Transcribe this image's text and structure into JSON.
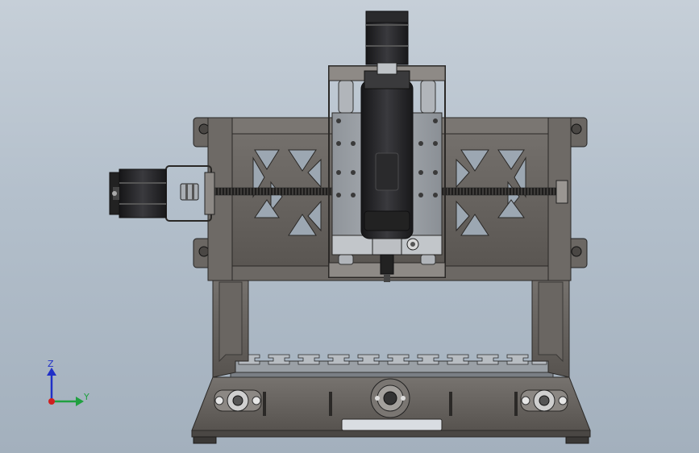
{
  "view": {
    "mode": "front view",
    "background": [
      "#c6cfd8",
      "#a3b0bd"
    ]
  },
  "model": {
    "name": "",
    "parts": [
      "frame",
      "gantry",
      "spindle-motor",
      "spindle-stepper",
      "y-stepper",
      "coupler",
      "lead-screw",
      "z-carriage",
      "t-slot-bed",
      "bearing-mounts",
      "feet"
    ]
  },
  "triad": {
    "z_label": "Z",
    "y_label": "Y",
    "colors": {
      "z": "#2030c8",
      "y": "#20a040",
      "x": "#d02020"
    }
  },
  "colors": {
    "metal_dark": "#5a5652",
    "metal_mid": "#6e6a66",
    "metal_light": "#8a8682",
    "steel_plate": "#9aa0a6",
    "motor_black": "#1e1e20"
  }
}
